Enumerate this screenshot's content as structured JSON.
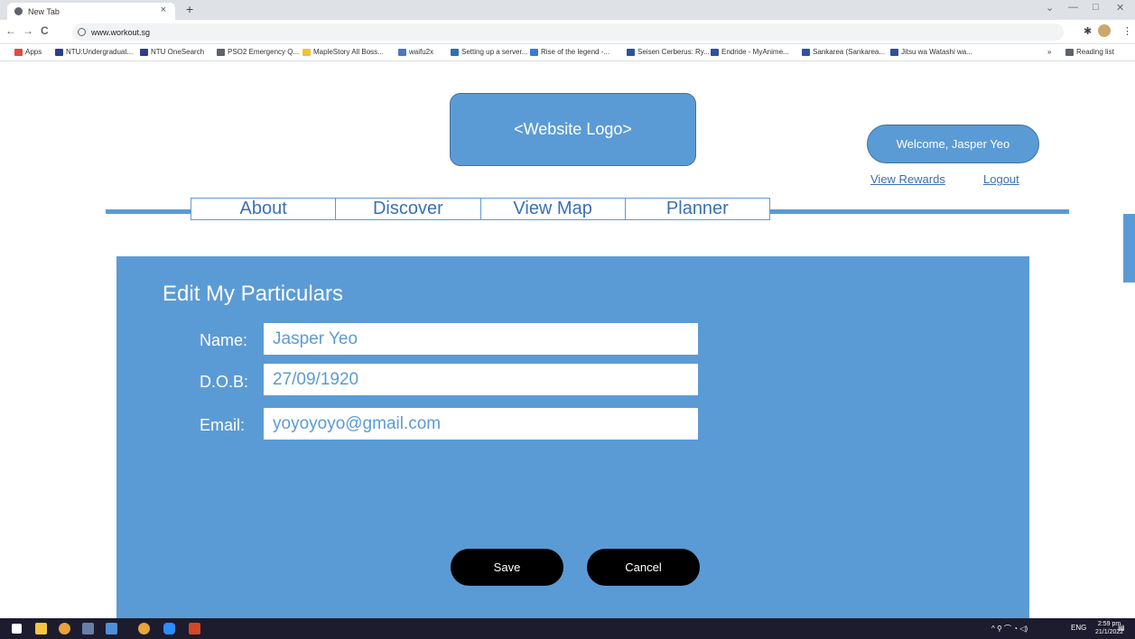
{
  "browser": {
    "tab_title": "New Tab",
    "tab_close": "×",
    "new_tab": "+",
    "back": "←",
    "forward": "→",
    "reload": "C",
    "url": "www.workout.sg",
    "bookmarks": [
      {
        "label": "Apps",
        "color": "#e04a3f"
      },
      {
        "label": "NTU:Undergraduat...",
        "color": "#2c3e8f"
      },
      {
        "label": "NTU OneSearch",
        "color": "#2c3e8f"
      },
      {
        "label": "PSO2 Emergency Q...",
        "color": "#5f6368"
      },
      {
        "label": "MapleStory All Boss...",
        "color": "#f2c232"
      },
      {
        "label": "waifu2x",
        "color": "#4a78c2"
      },
      {
        "label": "Setting up a server...",
        "color": "#2c6fb5"
      },
      {
        "label": "Rise of the legend -...",
        "color": "#3a7bd5"
      },
      {
        "label": "Seisen Cerberus: Ry...",
        "color": "#2e51a2"
      },
      {
        "label": "Endride - MyAnime...",
        "color": "#2e51a2"
      },
      {
        "label": "Sankarea (Sankarea...",
        "color": "#2e51a2"
      },
      {
        "label": "Jitsu wa Watashi wa...",
        "color": "#2e51a2"
      }
    ],
    "bookmarks_more": "»",
    "reading_list": "Reading list"
  },
  "header": {
    "logo_text": "<Website Logo>",
    "welcome": "Welcome, Jasper Yeo",
    "view_rewards": "View Rewards",
    "logout": "Logout"
  },
  "nav": [
    "About",
    "Discover",
    "View Map",
    "Planner"
  ],
  "form": {
    "title": "Edit My Particulars",
    "name_label": "Name:",
    "name_value": "Jasper Yeo",
    "dob_label": "D.O.B:",
    "dob_value": "27/09/1920",
    "email_label": "Email:",
    "email_value": "yoyoyoyo@gmail.com",
    "save": "Save",
    "cancel": "Cancel"
  },
  "taskbar": {
    "tray_text": "ENG",
    "time": "2:59 pm",
    "date": "21/1/2022"
  },
  "colors": {
    "accent": "#5b9bd5",
    "link": "#3b6fb6",
    "button": "#000000"
  }
}
